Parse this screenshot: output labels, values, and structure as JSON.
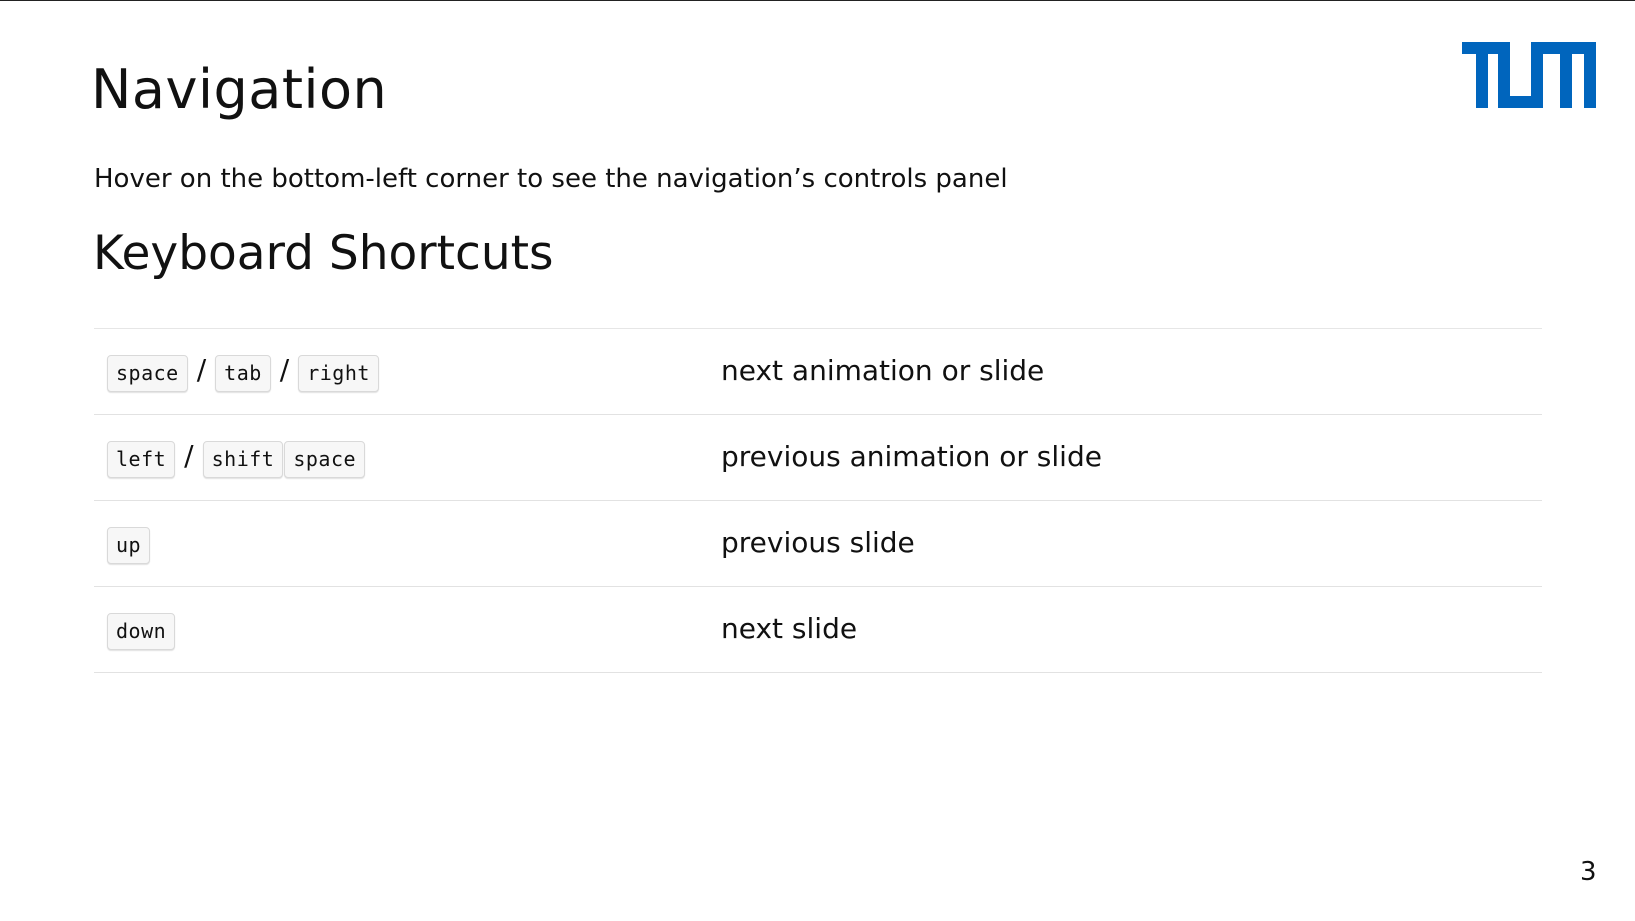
{
  "slide": {
    "title": "Navigation",
    "intro": "Hover on the bottom-left corner to see the navigation’s controls panel",
    "section_heading": "Keyboard Shortcuts",
    "page_number": "3",
    "logo_color": "#0065BD"
  },
  "shortcuts": [
    {
      "keys": [
        "space",
        "tab",
        "right"
      ],
      "separators": [
        "/",
        "/"
      ],
      "description": "next animation or slide"
    },
    {
      "keys": [
        "left",
        "shift",
        "space"
      ],
      "separators": [
        "/"
      ],
      "description": "previous animation or slide"
    },
    {
      "keys": [
        "up"
      ],
      "description": "previous slide"
    },
    {
      "keys": [
        "down"
      ],
      "description": "next slide"
    }
  ]
}
